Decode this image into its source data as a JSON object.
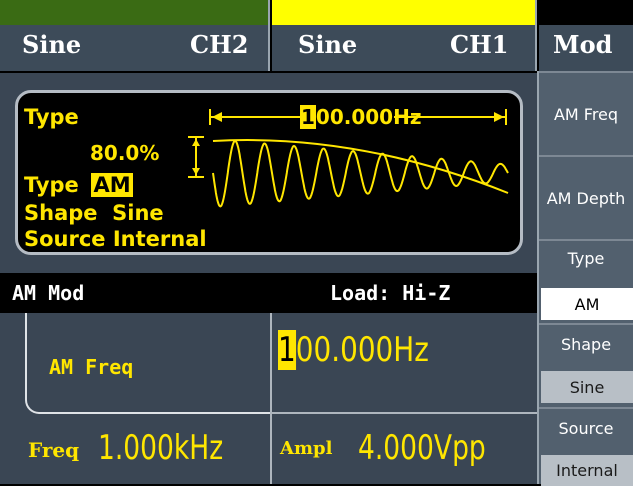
{
  "header": {
    "tab_ch2": {
      "waveform": "Sine",
      "channel": "CH2"
    },
    "tab_ch1": {
      "waveform": "Sine",
      "channel": "CH1"
    },
    "menu_title": "Mod"
  },
  "waveform_panel": {
    "type_label": "Type",
    "freq_span": "100.000Hz",
    "depth": "80.0%",
    "type_prefix": "Type",
    "type_value": "AM",
    "shape_line": "Shape  Sine",
    "source_line": "Source Internal"
  },
  "status_bar": {
    "mode": "AM Mod",
    "load": "Load: Hi-Z"
  },
  "param_area": {
    "selected_label": "AM Freq",
    "selected_value": "100.000Hz",
    "freq_label": "Freq",
    "freq_value": "1.000kHz",
    "ampl_label": "Ampl",
    "ampl_value": "4.000Vpp"
  },
  "softkeys": {
    "am_freq": "AM Freq",
    "am_depth": "AM Depth",
    "type_title": "Type",
    "type_value": "AM",
    "shape_title": "Shape",
    "shape_value": "Sine",
    "source_title": "Source",
    "source_value": "Internal"
  },
  "colors": {
    "ch1_bar": "#ffff00",
    "ch2_bar": "#3a6b14",
    "accent": "#ffe600"
  }
}
